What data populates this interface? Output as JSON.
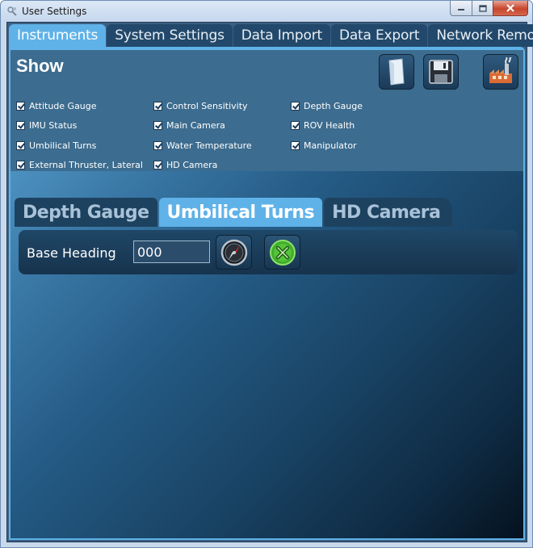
{
  "window": {
    "title": "User Settings"
  },
  "top_tabs": [
    {
      "label": "Instruments",
      "active": true
    },
    {
      "label": "System Settings",
      "active": false
    },
    {
      "label": "Data Import",
      "active": false
    },
    {
      "label": "Data Export",
      "active": false
    },
    {
      "label": "Network Remote",
      "active": false
    }
  ],
  "show": {
    "title": "Show",
    "toolbar": {
      "new_icon": "document-icon",
      "save_icon": "floppy-disk-icon",
      "factory_icon": "factory-icon"
    },
    "checkboxes": [
      {
        "label": "Attitude Gauge",
        "checked": true
      },
      {
        "label": "IMU Status",
        "checked": true
      },
      {
        "label": "Umbilical Turns",
        "checked": true
      },
      {
        "label": "External Thruster, Lateral",
        "checked": true
      },
      {
        "label": "Control Sensitivity",
        "checked": true
      },
      {
        "label": "Main Camera",
        "checked": true
      },
      {
        "label": "Water Temperature",
        "checked": true
      },
      {
        "label": "HD Camera",
        "checked": true
      },
      {
        "label": "Depth Gauge",
        "checked": true
      },
      {
        "label": "ROV Health",
        "checked": true
      },
      {
        "label": "Manipulator",
        "checked": true
      }
    ]
  },
  "sub_tabs": [
    {
      "label": "Depth Gauge",
      "active": false
    },
    {
      "label": "Umbilical Turns",
      "active": true
    },
    {
      "label": "HD Camera",
      "active": false
    }
  ],
  "umbilical": {
    "base_heading_label": "Base Heading",
    "base_heading_value": "000",
    "compass_icon": "compass-icon",
    "reset_icon": "green-x-reset-icon"
  },
  "colors": {
    "accent": "#5fb2e8",
    "tab_inactive": "#22496b",
    "panel_bg": "#3c6c8f"
  }
}
